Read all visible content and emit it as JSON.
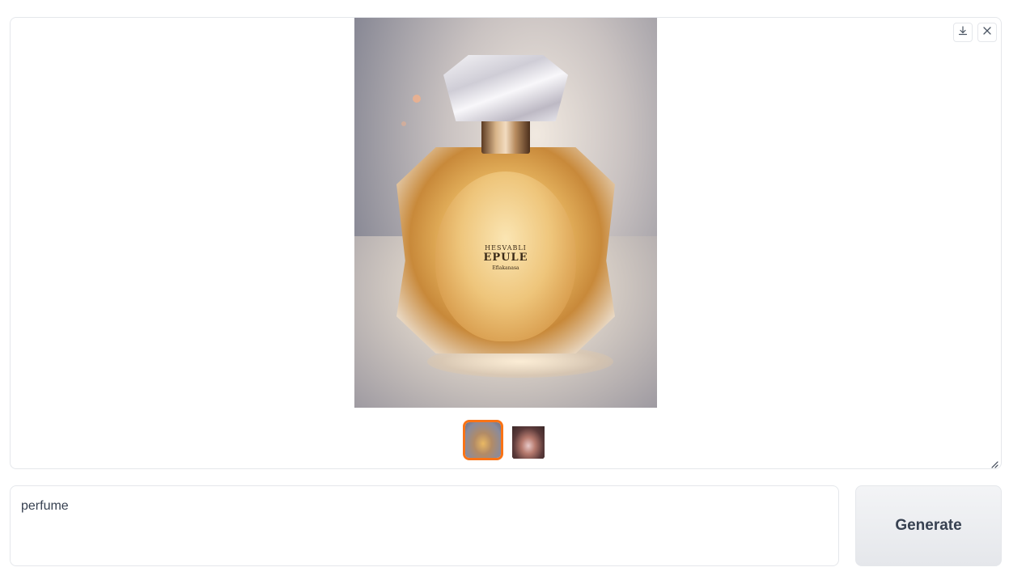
{
  "gallery": {
    "main_image": {
      "label_line1": "HESVABLI",
      "label_line2": "EPULE",
      "label_line3": "Eflakanasa"
    },
    "download_icon": "download-icon",
    "close_icon": "close-icon",
    "thumbnails": [
      {
        "name": "perfume-bottle-thumbnail",
        "selected": true
      },
      {
        "name": "perfume-portrait-thumbnail",
        "selected": false
      }
    ],
    "accent_color": "#f97316"
  },
  "prompt": {
    "value": "perfume"
  },
  "generate": {
    "label": "Generate"
  }
}
